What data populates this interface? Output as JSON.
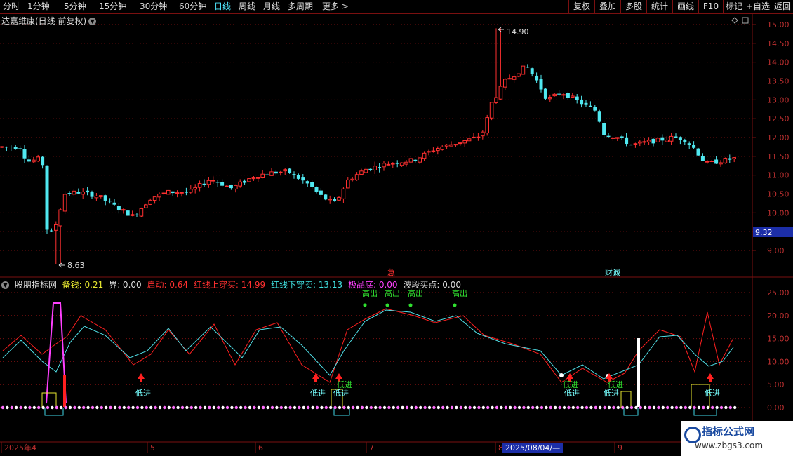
{
  "toolbar": {
    "periods": [
      "分时",
      "1分钟",
      "5分钟",
      "15分钟",
      "30分钟",
      "60分钟",
      "日线",
      "周线",
      "月线",
      "多周期",
      "更多 >"
    ],
    "active_period": "日线",
    "right_buttons": [
      "复权",
      "叠加",
      "多股",
      "统计",
      "画线",
      "F10",
      "标记",
      "+自选",
      "返回"
    ]
  },
  "stock": {
    "title": "达嘉维康(日线 前复权)",
    "price_max_label": "14.90",
    "price_min_label": "8.63",
    "last_price_label": "9.32",
    "annotation_1": "急",
    "annotation_2": "财诚"
  },
  "indicator": {
    "name": "股朋指标网",
    "params": [
      {
        "label": "备钱: 0.21",
        "color": "#e8e830"
      },
      {
        "label": "界: 0.00",
        "color": "#dddddd"
      },
      {
        "label": "启动: 0.64",
        "color": "#ff3030"
      },
      {
        "label": "红线上穿买: 14.99",
        "color": "#ff3030"
      },
      {
        "label": "红线下穿卖: 13.13",
        "color": "#40e0e0"
      },
      {
        "label": "极品底: 0.00",
        "color": "#ff40ff"
      },
      {
        "label": "波段买点: 0.00",
        "color": "#dddddd"
      }
    ],
    "signal_low": "低进",
    "signal_top": "高出"
  },
  "price_axis": {
    "ticks": [
      "15.00",
      "14.50",
      "14.00",
      "13.50",
      "13.00",
      "12.50",
      "12.00",
      "11.50",
      "11.00",
      "10.50",
      "10.00",
      "9.50",
      "9.00"
    ]
  },
  "ind_axis": {
    "ticks": [
      "25.00",
      "20.00",
      "15.00",
      "10.00",
      "5.00",
      "0.00"
    ]
  },
  "date_axis": {
    "labels": [
      "2025年4",
      "5",
      "6",
      "7",
      "8",
      "9"
    ],
    "highlight": "2025/08/04/—"
  },
  "watermark": {
    "line1": "指标公式网",
    "line2": "www.zbgs3.com"
  },
  "colors": {
    "up": "#ff3030",
    "down": "#50e8f0",
    "grid": "#7a1010",
    "red_line": "#ff2020",
    "cyan_line": "#50e0e8"
  }
}
